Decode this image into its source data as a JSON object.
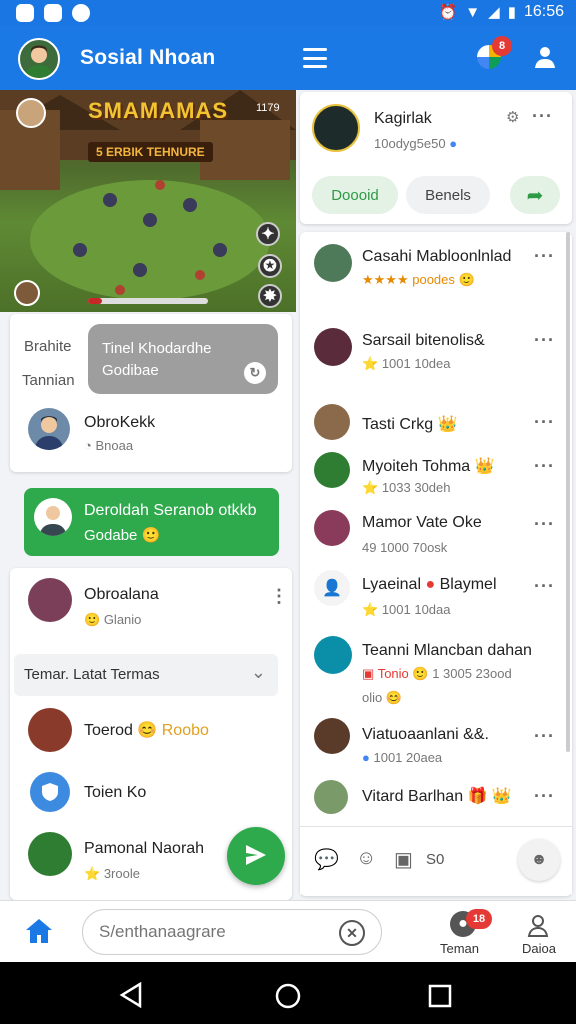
{
  "status": {
    "time": "16:56"
  },
  "appbar": {
    "title": "Sosial Nhoan",
    "notif_count": "8"
  },
  "game": {
    "banner": "SMAMAMAS",
    "subtitle": "5 ERBIK TEHNURE",
    "counter": "1179"
  },
  "left_panel": {
    "label1": "Brahite",
    "label2": "Tannian",
    "gray_bubble_line1": "Tinel Khodardhe",
    "gray_bubble_line2": "Godibae",
    "user1": {
      "name": "ObroKekk",
      "status": "Bnoaa"
    },
    "green_bubble_line1": "Deroldah Seranob otkkb",
    "green_bubble_line2": "Godabe",
    "user2": {
      "name": "Obroalana",
      "status": "Glanio"
    },
    "dropdown_label": "Temar. Latat Termas",
    "friends": [
      {
        "name": "Toerod",
        "status": "Roobo"
      },
      {
        "name": "Toien Ko"
      },
      {
        "name": "Pamonal Naorah",
        "status": "3roole"
      }
    ]
  },
  "right_panel": {
    "profile": {
      "name": "Kagirlak",
      "subtitle": "10odyg5e50"
    },
    "chips": [
      "Doooid",
      "Benels"
    ],
    "items": [
      {
        "name": "Casahi Mabloonlnlad",
        "sub": "poodes"
      },
      {
        "name": "Sarsail bitenolis&",
        "sub": "1001 10dea"
      },
      {
        "name": "Tasti Crkg"
      },
      {
        "name": "Myoiteh Tohma",
        "sub": "1033 30deh"
      },
      {
        "name": "Mamor Vate Oke",
        "sub": "49 1000 70osk"
      },
      {
        "name": "Lyaeinal",
        "name2": "Blaymel",
        "sub": "1001 10daa"
      },
      {
        "name": "Teanni Mlancban dahan",
        "sub": "Tonio",
        "sub2": "1 3005 23ood",
        "sub3": "olio"
      },
      {
        "name": "Viatuoaanlani &&.",
        "sub": "1001 20aea"
      },
      {
        "name": "Vitard Barlhan"
      }
    ],
    "action_count": "S0"
  },
  "bottom": {
    "search_placeholder": "S/enthanaagrare",
    "tab1": "Teman",
    "tab1_badge": "18",
    "tab2": "Daioa"
  },
  "colors": {
    "primary": "#1b79e6",
    "green": "#2eaa4d",
    "badge": "#e53935"
  }
}
